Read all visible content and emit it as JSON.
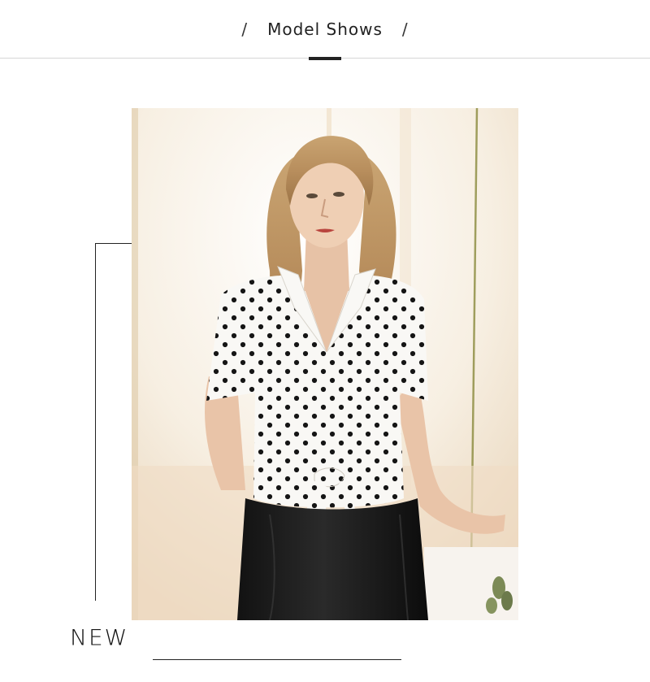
{
  "header": {
    "title": "Model Shows",
    "slash_left": "/",
    "slash_right": "/"
  },
  "photo": {
    "alt": "Model wearing a white polka dot tie-front short sleeve blouse with a black leather skirt"
  },
  "footer": {
    "label": "NEW"
  },
  "colors": {
    "text": "#222222",
    "rule": "#d6d6d6",
    "accent": "#222222"
  }
}
